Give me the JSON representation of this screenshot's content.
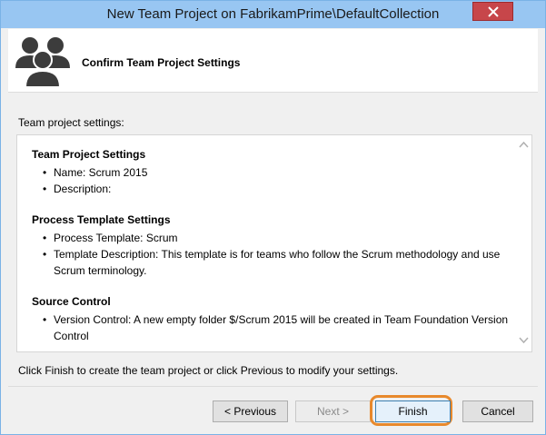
{
  "window": {
    "title": "New Team Project on FabrikamPrime\\DefaultCollection",
    "accent": "#98c6f2",
    "close_color": "#c7464a"
  },
  "header": {
    "icon": "team-icon",
    "title": "Confirm Team Project Settings"
  },
  "content": {
    "settings_label": "Team project settings:",
    "sections": [
      {
        "heading": "Team Project Settings",
        "items": [
          "Name: Scrum 2015",
          "Description:"
        ]
      },
      {
        "heading": "Process Template Settings",
        "items": [
          "Process Template: Scrum",
          "Template Description: This template is for teams who follow the Scrum methodology and use Scrum terminology."
        ]
      },
      {
        "heading": "Source Control",
        "items": [
          "Version Control: A new empty folder $/Scrum 2015 will be created in Team Foundation Version Control"
        ]
      }
    ],
    "footer_text": "Click Finish to create the team project or click Previous to modify your settings."
  },
  "buttons": {
    "previous": "< Previous",
    "next": "Next >",
    "finish": "Finish",
    "cancel": "Cancel",
    "highlight_color": "#e8892c"
  }
}
